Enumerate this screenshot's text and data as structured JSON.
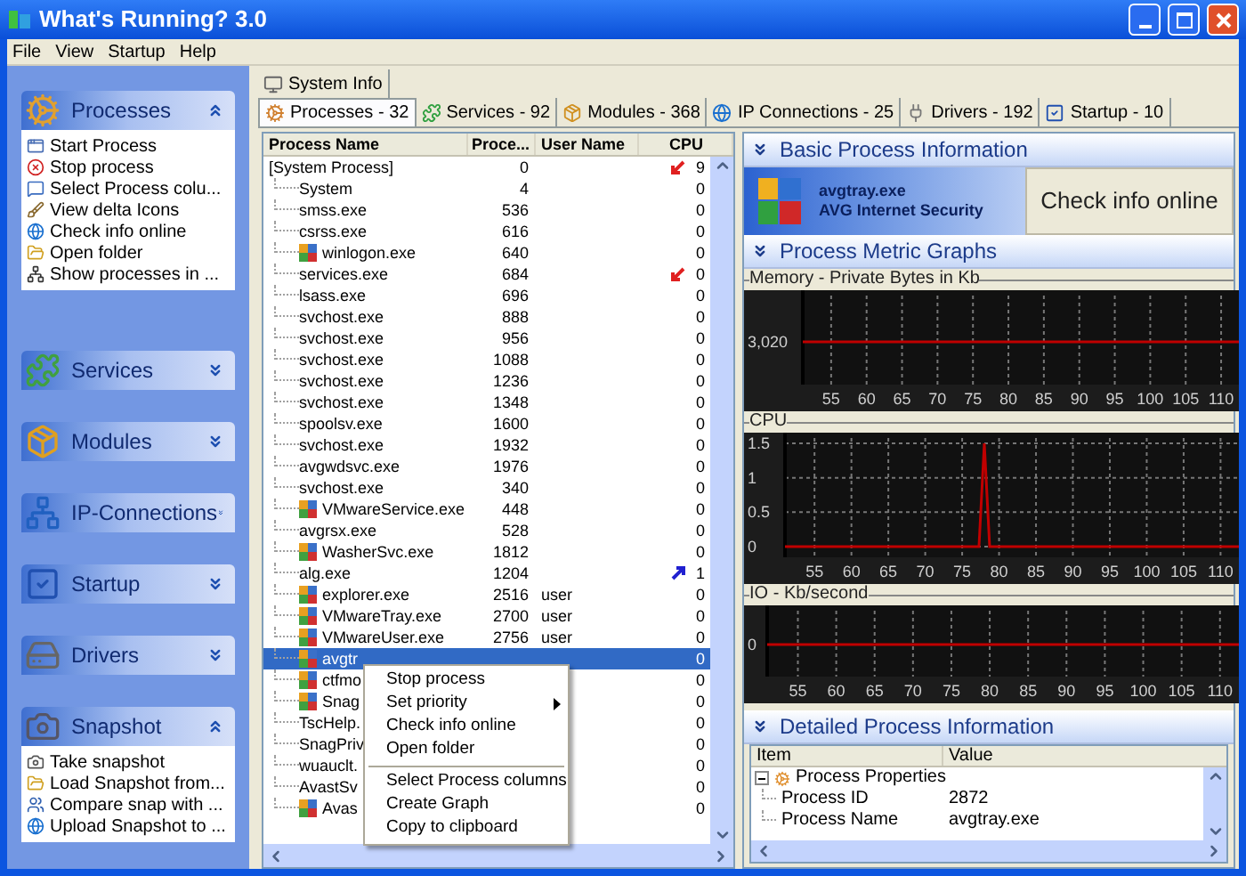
{
  "window": {
    "title": "What's Running? 3.0"
  },
  "menu": [
    "File",
    "View",
    "Startup",
    "Help"
  ],
  "sidebar": {
    "sections": [
      {
        "title": "Processes",
        "expanded": true,
        "items": [
          "Start Process",
          "Stop process",
          "Select Process colu...",
          "View delta Icons",
          "Check info online",
          "Open folder",
          "Show processes in ..."
        ]
      },
      {
        "title": "Services",
        "expanded": false
      },
      {
        "title": "Modules",
        "expanded": false
      },
      {
        "title": "IP-Connections",
        "expanded": false
      },
      {
        "title": "Startup",
        "expanded": false
      },
      {
        "title": "Drivers",
        "expanded": false
      },
      {
        "title": "Snapshot",
        "expanded": true,
        "items": [
          "Take snapshot",
          "Load Snapshot from...",
          "Compare snap with ...",
          "Upload Snapshot to ..."
        ]
      }
    ]
  },
  "top_tabs": [
    {
      "label": "System Info",
      "selected": false
    }
  ],
  "tabs": [
    {
      "label": "Processes - 32",
      "selected": true
    },
    {
      "label": "Services - 92",
      "selected": false
    },
    {
      "label": "Modules - 368",
      "selected": false
    },
    {
      "label": "IP Connections - 25",
      "selected": false
    },
    {
      "label": "Drivers - 192",
      "selected": false
    },
    {
      "label": "Startup - 10",
      "selected": false
    }
  ],
  "process_table": {
    "columns": [
      "Process Name",
      "Proce...",
      "User Name",
      "CPU"
    ],
    "rows": [
      {
        "name": "[System Process]",
        "pid": "0",
        "cpu": "9",
        "arrow": {
          "kind": "down"
        },
        "kind": "plain",
        "selected": false,
        "children": [
          {
            "name": "System",
            "pid": "4",
            "cpu": "0",
            "kind": "plain",
            "selected": false
          },
          {
            "name": "smss.exe",
            "pid": "536",
            "cpu": "0",
            "kind": "plain",
            "selected": false
          },
          {
            "name": "csrss.exe",
            "pid": "616",
            "cpu": "0",
            "kind": "plain",
            "selected": false
          },
          {
            "name": "winlogon.exe",
            "pid": "640",
            "cpu": "0",
            "kind": "icon",
            "selected": false
          },
          {
            "name": "services.exe",
            "pid": "684",
            "cpu": "0",
            "arrow": {
              "kind": "down"
            },
            "kind": "plain",
            "selected": false
          },
          {
            "name": "lsass.exe",
            "pid": "696",
            "cpu": "0",
            "kind": "plain",
            "selected": false
          },
          {
            "name": "svchost.exe",
            "pid": "888",
            "cpu": "0",
            "kind": "plain",
            "selected": false
          },
          {
            "name": "svchost.exe",
            "pid": "956",
            "cpu": "0",
            "kind": "plain",
            "selected": false
          },
          {
            "name": "svchost.exe",
            "pid": "1088",
            "cpu": "0",
            "kind": "plain",
            "selected": false
          },
          {
            "name": "svchost.exe",
            "pid": "1236",
            "cpu": "0",
            "kind": "plain",
            "selected": false
          },
          {
            "name": "svchost.exe",
            "pid": "1348",
            "cpu": "0",
            "kind": "plain",
            "selected": false
          },
          {
            "name": "spoolsv.exe",
            "pid": "1600",
            "cpu": "0",
            "kind": "plain",
            "selected": false
          },
          {
            "name": "svchost.exe",
            "pid": "1932",
            "cpu": "0",
            "kind": "plain",
            "selected": false
          },
          {
            "name": "avgwdsvc.exe",
            "pid": "1976",
            "cpu": "0",
            "kind": "plain",
            "selected": false
          },
          {
            "name": "svchost.exe",
            "pid": "340",
            "cpu": "0",
            "kind": "plain",
            "selected": false
          },
          {
            "name": "VMwareService.exe",
            "pid": "448",
            "cpu": "0",
            "kind": "icon",
            "selected": false
          },
          {
            "name": "avgrsx.exe",
            "pid": "528",
            "cpu": "0",
            "kind": "plain",
            "selected": false
          },
          {
            "name": "WasherSvc.exe",
            "pid": "1812",
            "cpu": "0",
            "kind": "icon",
            "selected": false
          },
          {
            "name": "alg.exe",
            "pid": "1204",
            "cpu": "1",
            "arrow": {
              "kind": "up"
            },
            "kind": "plain",
            "selected": false
          },
          {
            "name": "explorer.exe",
            "pid": "2516",
            "user": "user",
            "cpu": "0",
            "kind": "icon",
            "selected": false
          },
          {
            "name": "VMwareTray.exe",
            "pid": "2700",
            "user": "user",
            "cpu": "0",
            "kind": "icon",
            "selected": false
          },
          {
            "name": "VMwareUser.exe",
            "pid": "2756",
            "user": "user",
            "cpu": "0",
            "kind": "icon",
            "selected": false
          },
          {
            "name": "avgtr",
            "cpu": "0",
            "kind": "icon",
            "selected": true
          },
          {
            "name": "ctfmo",
            "cpu": "0",
            "kind": "icon",
            "selected": false
          },
          {
            "name": "Snag",
            "cpu": "0",
            "kind": "icon",
            "selected": false
          },
          {
            "name": "TscHelp.",
            "cpu": "0",
            "kind": "plain",
            "selected": false
          },
          {
            "name": "SnagPriv",
            "cpu": "0",
            "kind": "plain",
            "selected": false
          },
          {
            "name": "wuauclt.",
            "cpu": "0",
            "kind": "plain",
            "selected": false
          },
          {
            "name": "AvastSv",
            "cpu": "0",
            "kind": "plain",
            "selected": false
          },
          {
            "name": "Avas",
            "cpu": "0",
            "kind": "icon",
            "selected": false
          }
        ]
      }
    ]
  },
  "context_menu": {
    "items": [
      {
        "kind": "item",
        "label": "Stop process"
      },
      {
        "kind": "item",
        "label": "Set priority",
        "submenu": true
      },
      {
        "kind": "item",
        "label": "Check info online"
      },
      {
        "kind": "item",
        "label": "Open folder"
      },
      {
        "kind": "separator"
      },
      {
        "kind": "item",
        "label": "Select Process columns"
      },
      {
        "kind": "item",
        "label": "Create Graph"
      },
      {
        "kind": "item",
        "label": "Copy to clipboard"
      }
    ]
  },
  "basic_info": {
    "title": "Basic Process Information",
    "file": "avgtray.exe",
    "product": "AVG Internet Security",
    "button": "Check info online"
  },
  "graphs": {
    "title": "Process Metric Graphs",
    "items": [
      {
        "title": "Memory - Private Bytes in Kb",
        "kind": "picture",
        "axis_labels": [
          "55",
          "60",
          "65",
          "70",
          "75",
          "80",
          "85",
          "90",
          "95",
          "100",
          "105",
          "110"
        ],
        "value_labels": [
          "3,020"
        ]
      },
      {
        "title": "CPU",
        "kind": "picture",
        "axis_labels": [
          "55",
          "60",
          "65",
          "70",
          "75",
          "80",
          "85",
          "90",
          "95",
          "100",
          "105",
          "110"
        ],
        "value_labels": [
          "1.5",
          "1",
          "0.5",
          "0"
        ]
      },
      {
        "title": "IO - Kb/second",
        "kind": "picture",
        "axis_labels": [
          "55",
          "60",
          "65",
          "70",
          "75",
          "80",
          "85",
          "90",
          "95",
          "100",
          "105",
          "110"
        ],
        "value_labels": [
          "0"
        ]
      }
    ]
  },
  "details": {
    "title": "Detailed Process Information",
    "columns": [
      "Item",
      "Value"
    ],
    "rows": [
      {
        "item": "Process Properties",
        "expanded": true,
        "children": [
          {
            "item": "Process ID",
            "value": "2872"
          },
          {
            "item": "Process Name",
            "value": "avgtray.exe"
          }
        ]
      }
    ]
  }
}
